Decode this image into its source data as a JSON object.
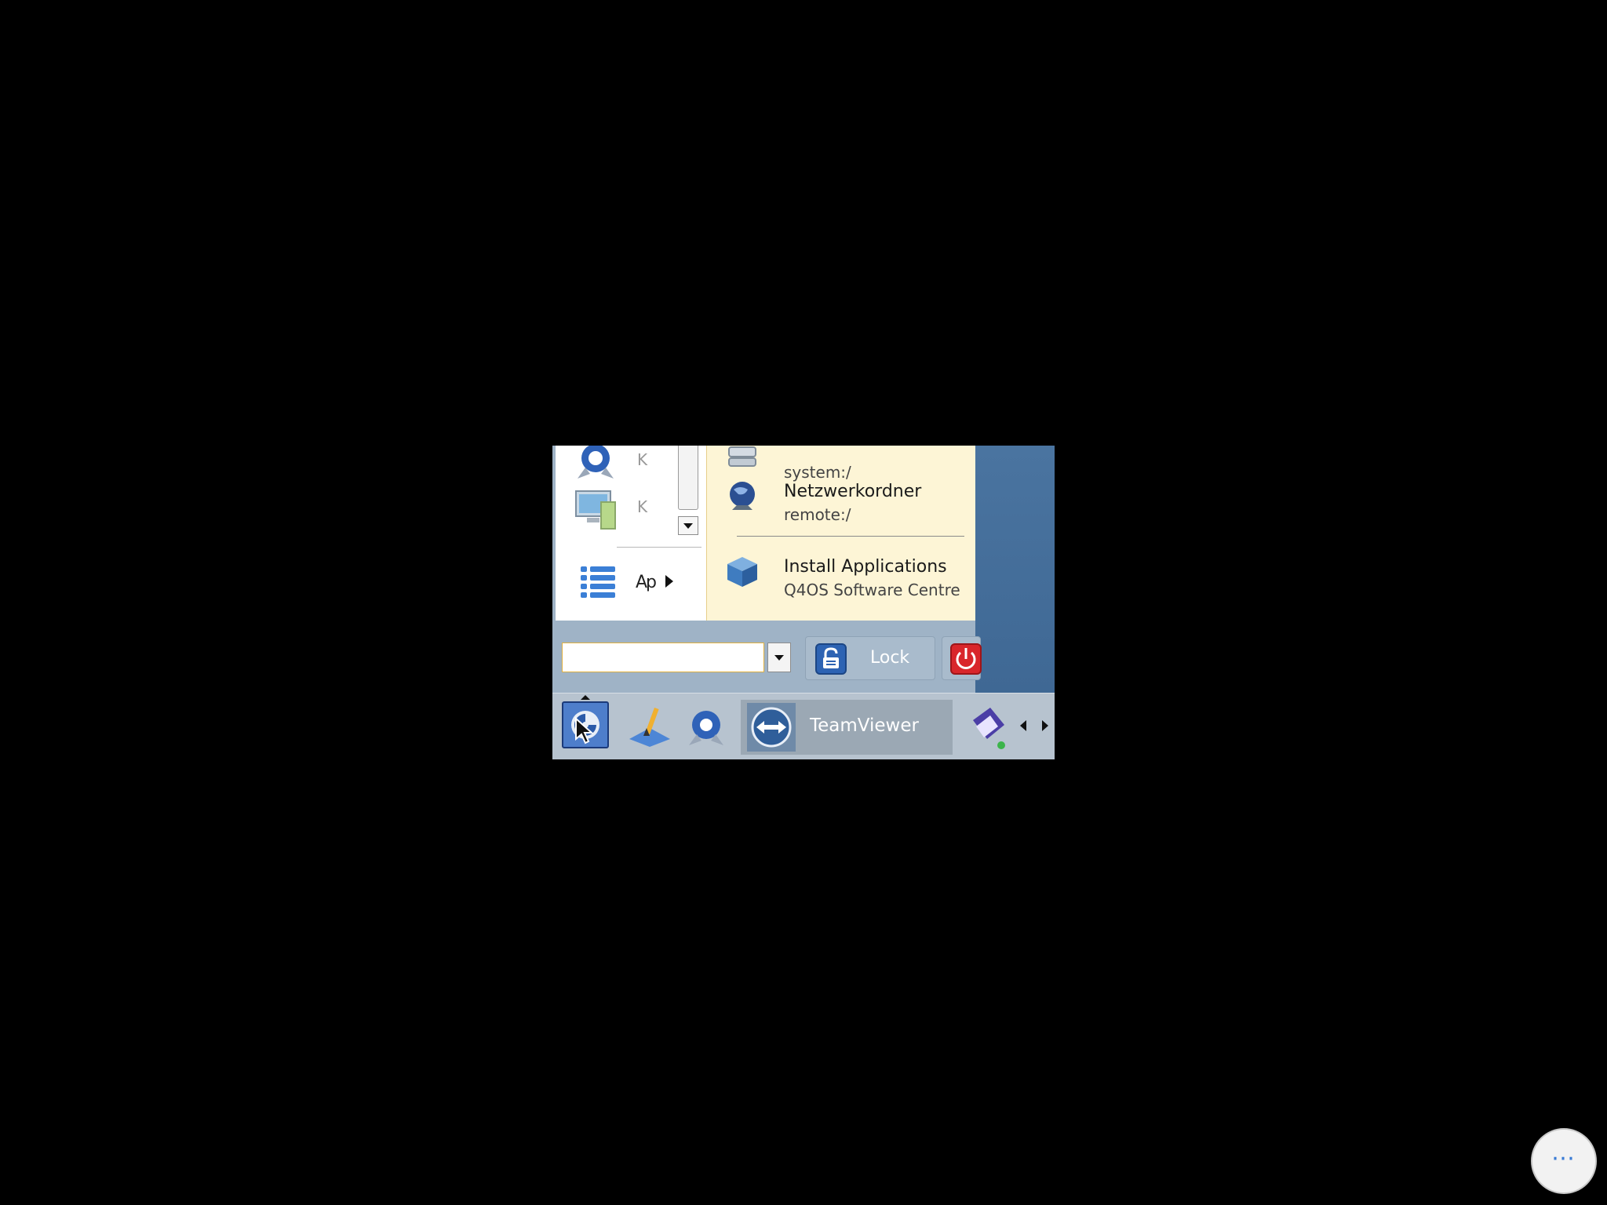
{
  "menu": {
    "left_items": [
      {
        "label": "K",
        "icon": "kde-gear-icon"
      },
      {
        "label": "K",
        "icon": "computer-icon"
      }
    ],
    "applications_label": "Ap",
    "places": [
      {
        "title": "",
        "subtitle": "system:/",
        "icon": "system-icon"
      },
      {
        "title": "Netzwerkordner",
        "subtitle": "remote:/",
        "icon": "network-globe-icon"
      },
      {
        "title": "Install Applications",
        "subtitle": "Q4OS Software Centre",
        "icon": "package-box-icon"
      }
    ]
  },
  "bottom": {
    "search_value": "",
    "lock_label": "Lock"
  },
  "taskbar": {
    "tasks": [
      {
        "label": "TeamViewer",
        "icon": "teamviewer-icon"
      }
    ]
  },
  "overlay": {
    "more_label": "⋯"
  },
  "colors": {
    "desktop": "#4a74a0",
    "menu_places_bg": "#fdf5d6",
    "taskbar": "#b7c3cf",
    "power_red": "#d9262b"
  }
}
